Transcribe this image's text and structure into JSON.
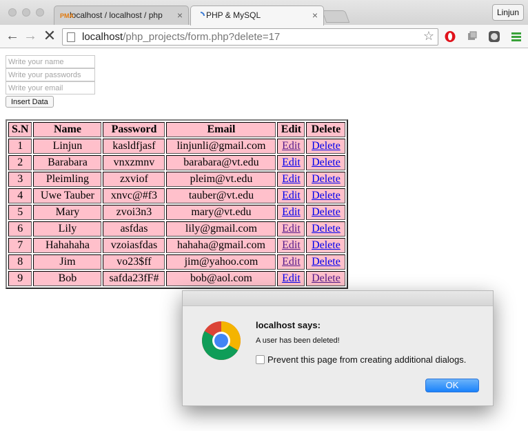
{
  "browser": {
    "tabs": [
      {
        "title": "localhost / localhost / php",
        "favicon": "phpmyadmin-icon",
        "active": false
      },
      {
        "title": "PHP & MySQL",
        "favicon": "loading-spinner-icon",
        "active": true
      }
    ],
    "profile_name": "Linjun",
    "url_host": "localhost",
    "url_path": "/php_projects/form.php?delete=17"
  },
  "form": {
    "name_placeholder": "Write your name",
    "password_placeholder": "Write your passwords",
    "email_placeholder": "Write your email",
    "submit_label": "Insert Data"
  },
  "table": {
    "headers": [
      "S.N",
      "Name",
      "Password",
      "Email",
      "Edit",
      "Delete"
    ],
    "rows": [
      {
        "sn": "1",
        "name": "Linjun",
        "password": "kasldfjasf",
        "email": "linjunli@gmail.com",
        "edit": "Edit",
        "delete": "Delete"
      },
      {
        "sn": "2",
        "name": "Barabara",
        "password": "vnxzmnv",
        "email": "barabara@vt.edu",
        "edit": "Edit",
        "delete": "Delete"
      },
      {
        "sn": "3",
        "name": "Pleimling",
        "password": "zxviof",
        "email": "pleim@vt.edu",
        "edit": "Edit",
        "delete": "Delete"
      },
      {
        "sn": "4",
        "name": "Uwe Tauber",
        "password": "xnvc@#f3",
        "email": "tauber@vt.edu",
        "edit": "Edit",
        "delete": "Delete"
      },
      {
        "sn": "5",
        "name": "Mary",
        "password": "zvoi3n3",
        "email": "mary@vt.edu",
        "edit": "Edit",
        "delete": "Delete"
      },
      {
        "sn": "6",
        "name": "Lily",
        "password": "asfdas",
        "email": "lily@gmail.com",
        "edit": "Edit",
        "delete": "Delete"
      },
      {
        "sn": "7",
        "name": "Hahahaha",
        "password": "vzoiasfdas",
        "email": "hahaha@gmail.com",
        "edit": "Edit",
        "delete": "Delete"
      },
      {
        "sn": "8",
        "name": "Jim",
        "password": "vo23$ff",
        "email": "jim@yahoo.com",
        "edit": "Edit",
        "delete": "Delete"
      },
      {
        "sn": "9",
        "name": "Bob",
        "password": "safda23fF#",
        "email": "bob@aol.com",
        "edit": "Edit",
        "delete": "Delete"
      }
    ]
  },
  "dialog": {
    "title": "localhost says:",
    "message": "A user has been deleted!",
    "checkbox_label": "Prevent this page from creating additional dialogs.",
    "ok_label": "OK",
    "icon": "chrome-logo-icon"
  },
  "colors": {
    "table_cell": "#ffc0cb",
    "link": "#0000ee",
    "visited_link": "#551a8b",
    "ok_button": "#1a82fb"
  }
}
